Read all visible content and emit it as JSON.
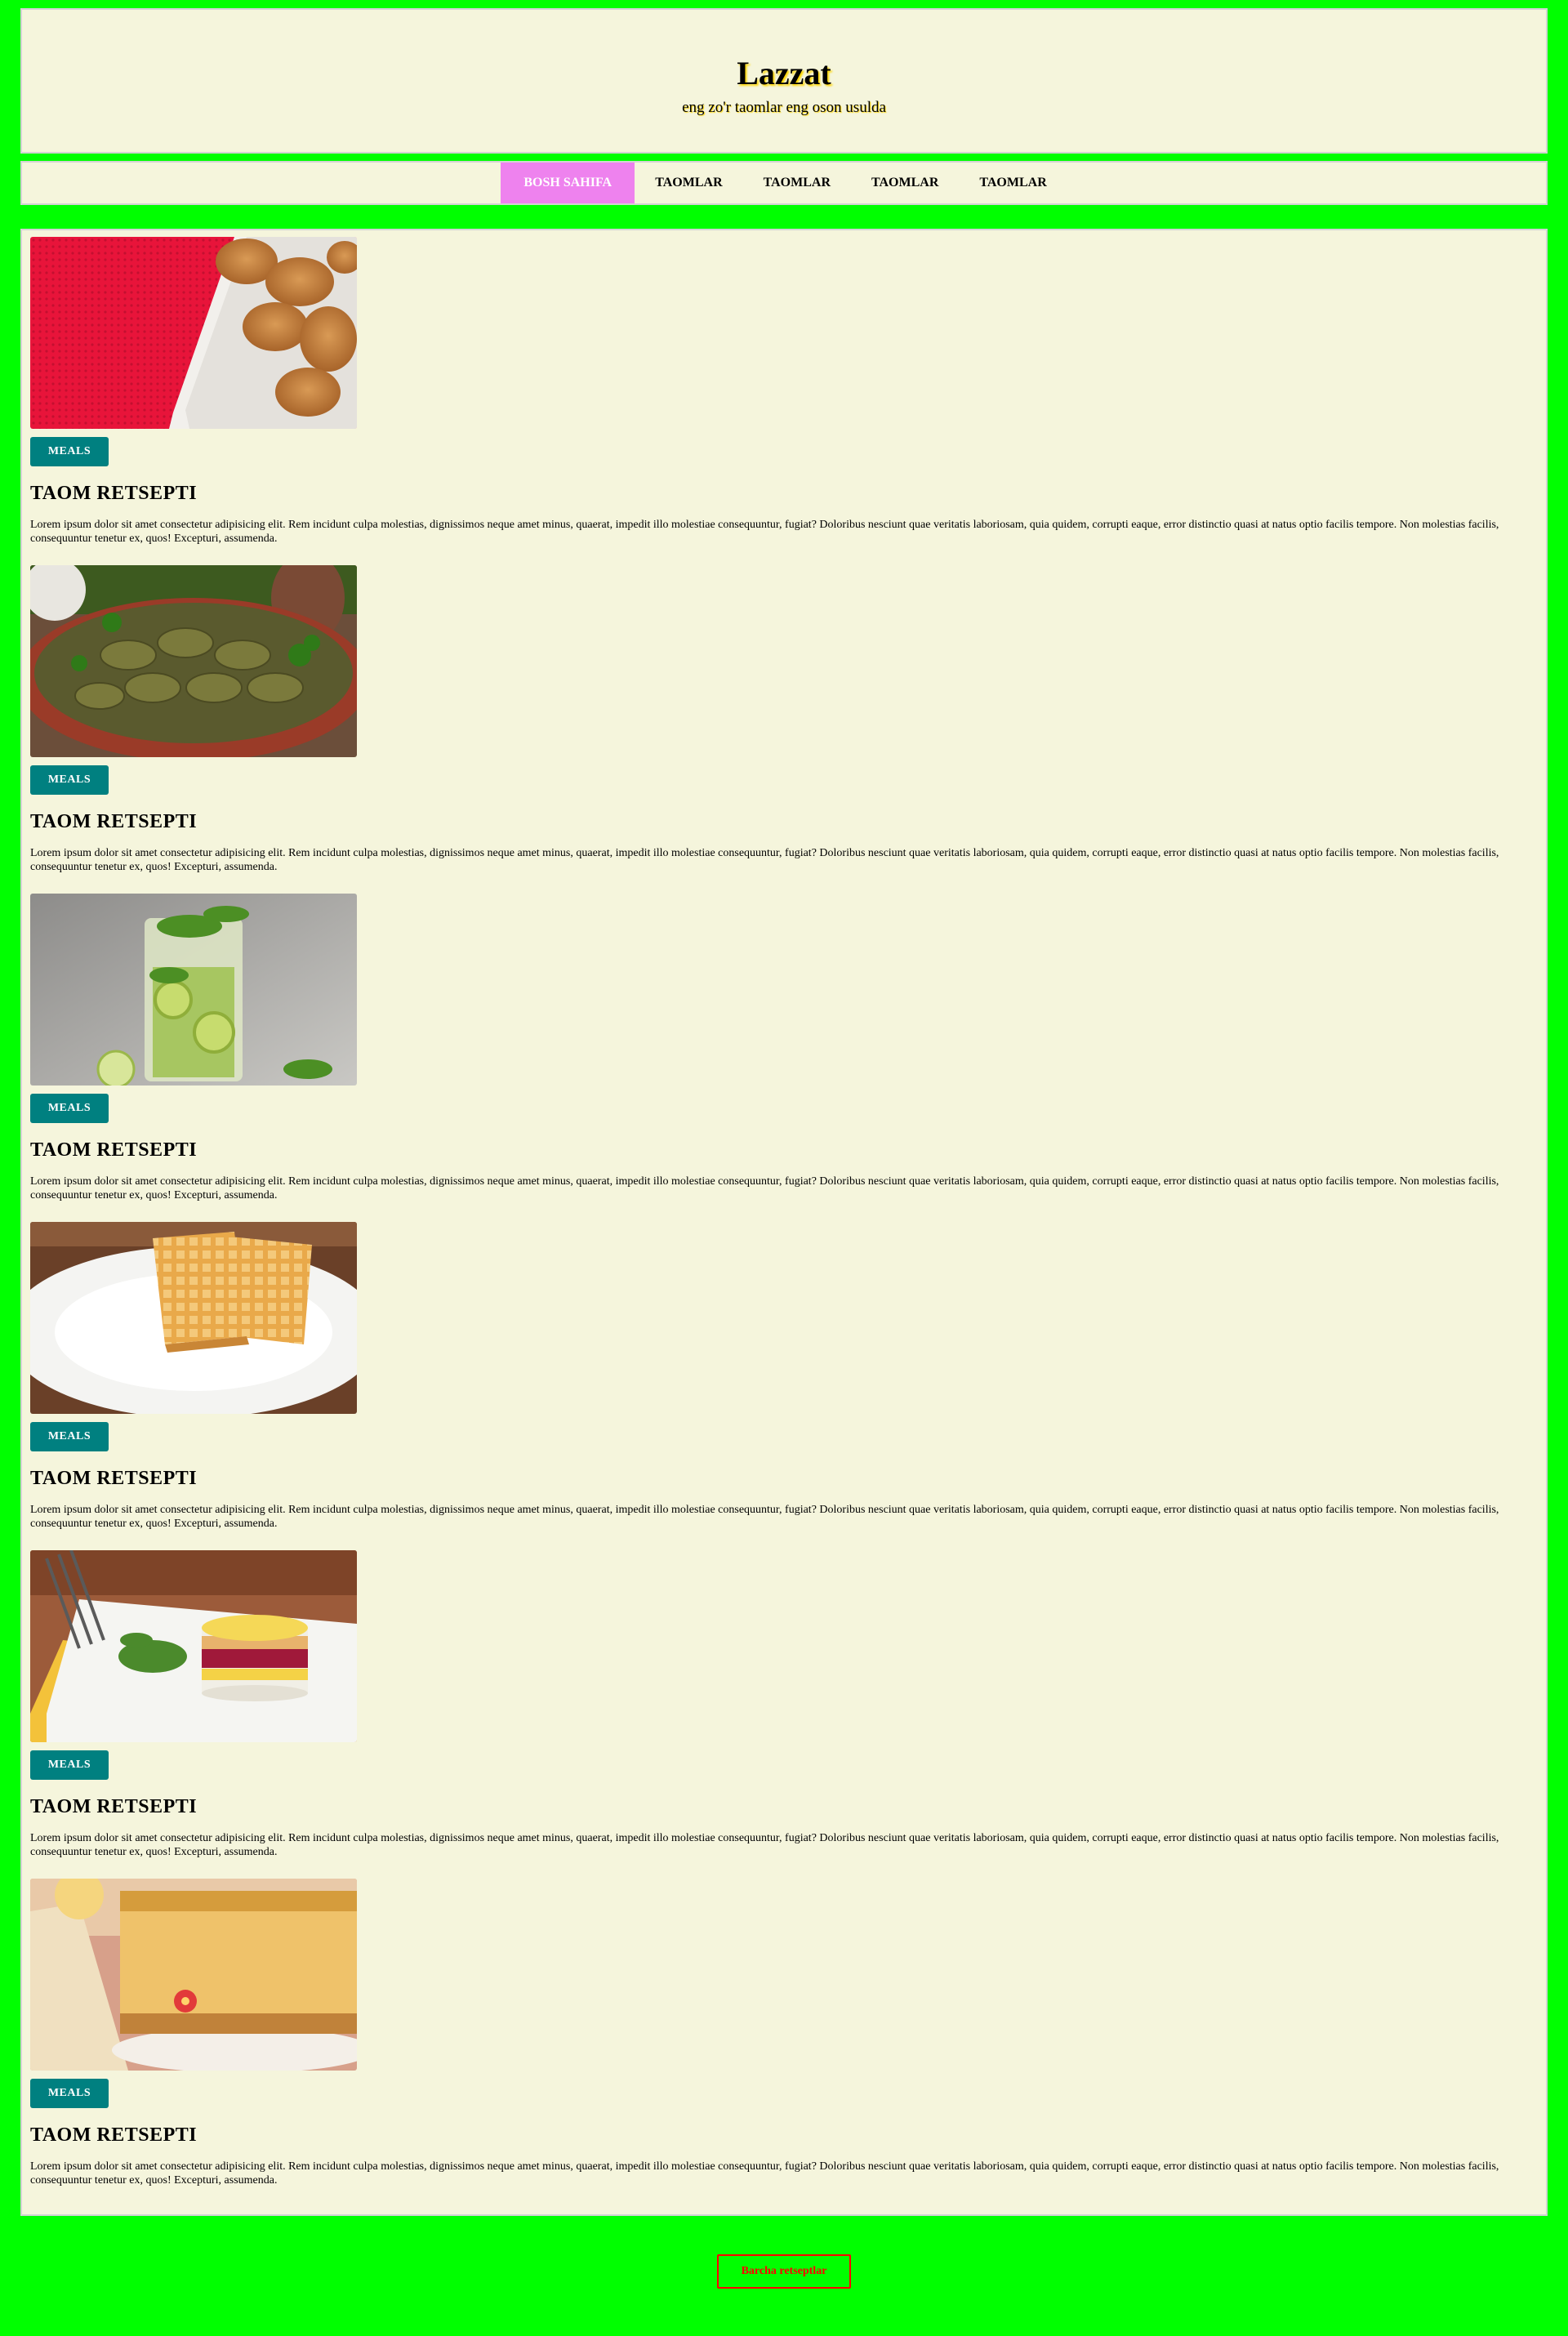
{
  "header": {
    "title": "Lazzat",
    "tagline": "eng zo'r taomlar eng oson usulda"
  },
  "nav": {
    "items": [
      {
        "label": "BOSH SAHIFA",
        "active": true
      },
      {
        "label": "TAOMLAR",
        "active": false
      },
      {
        "label": "TAOMLAR",
        "active": false
      },
      {
        "label": "TAOMLAR",
        "active": false
      },
      {
        "label": "TAOMLAR",
        "active": false
      }
    ]
  },
  "cards": [
    {
      "image": "fried-chicken-image",
      "tag": "MEALS",
      "title": "TAOM RETSEPTI",
      "text": "Lorem ipsum dolor sit amet consectetur adipisicing elit. Rem incidunt culpa molestias, dignissimos neque amet minus, quaerat, impedit illo molestiae consequuntur, fugiat? Doloribus nesciunt quae veritatis laboriosam, quia quidem, corrupti eaque, error distinctio quasi at natus optio facilis tempore. Non molestias facilis, consequuntur tenetur ex, quos! Excepturi, assumenda."
    },
    {
      "image": "stuffed-grape-leaves-image",
      "tag": "MEALS",
      "title": "TAOM RETSEPTI",
      "text": "Lorem ipsum dolor sit amet consectetur adipisicing elit. Rem incidunt culpa molestias, dignissimos neque amet minus, quaerat, impedit illo molestiae consequuntur, fugiat? Doloribus nesciunt quae veritatis laboriosam, quia quidem, corrupti eaque, error distinctio quasi at natus optio facilis tempore. Non molestias facilis, consequuntur tenetur ex, quos! Excepturi, assumenda."
    },
    {
      "image": "mojito-drink-image",
      "tag": "MEALS",
      "title": "TAOM RETSEPTI",
      "text": "Lorem ipsum dolor sit amet consectetur adipisicing elit. Rem incidunt culpa molestias, dignissimos neque amet minus, quaerat, impedit illo molestiae consequuntur, fugiat? Doloribus nesciunt quae veritatis laboriosam, quia quidem, corrupti eaque, error distinctio quasi at natus optio facilis tempore. Non molestias facilis, consequuntur tenetur ex, quos! Excepturi, assumenda."
    },
    {
      "image": "waffles-image",
      "tag": "MEALS",
      "title": "TAOM RETSEPTI",
      "text": "Lorem ipsum dolor sit amet consectetur adipisicing elit. Rem incidunt culpa molestias, dignissimos neque amet minus, quaerat, impedit illo molestiae consequuntur, fugiat? Doloribus nesciunt quae veritatis laboriosam, quia quidem, corrupti eaque, error distinctio quasi at natus optio facilis tempore. Non molestias facilis, consequuntur tenetur ex, quos! Excepturi, assumenda."
    },
    {
      "image": "layered-salad-image",
      "tag": "MEALS",
      "title": "TAOM RETSEPTI",
      "text": "Lorem ipsum dolor sit amet consectetur adipisicing elit. Rem incidunt culpa molestias, dignissimos neque amet minus, quaerat, impedit illo molestiae consequuntur, fugiat? Doloribus nesciunt quae veritatis laboriosam, quia quidem, corrupti eaque, error distinctio quasi at natus optio facilis tempore. Non molestias facilis, consequuntur tenetur ex, quos! Excepturi, assumenda."
    },
    {
      "image": "cheesecake-image",
      "tag": "MEALS",
      "title": "TAOM RETSEPTI",
      "text": "Lorem ipsum dolor sit amet consectetur adipisicing elit. Rem incidunt culpa molestias, dignissimos neque amet minus, quaerat, impedit illo molestiae consequuntur, fugiat? Doloribus nesciunt quae veritatis laboriosam, quia quidem, corrupti eaque, error distinctio quasi at natus optio facilis tempore. Non molestias facilis, consequuntur tenetur ex, quos! Excepturi, assumenda."
    }
  ],
  "footer": {
    "button_label": "Barcha retseptlar"
  },
  "colors": {
    "page_background": "#00ff00",
    "panel_background": "#f5f5dc",
    "nav_active": "#ee82ee",
    "tag_button": "#008080",
    "footer_button": "#ff0000"
  }
}
